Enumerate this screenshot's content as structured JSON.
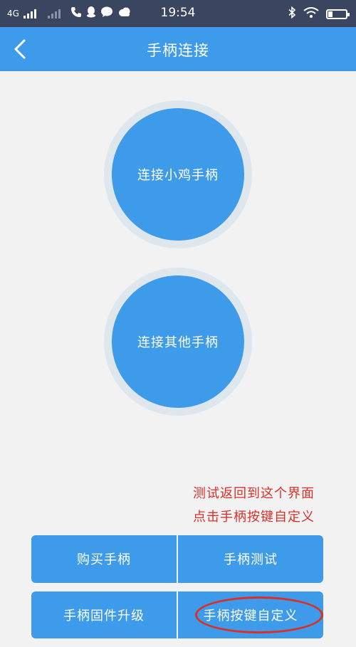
{
  "status_bar": {
    "network": "4G",
    "time": "19:54"
  },
  "header": {
    "title": "手柄连接"
  },
  "circles": {
    "connect_xiaoji": "连接小鸡手柄",
    "connect_other": "连接其他手柄"
  },
  "annotation": {
    "line1": "测试返回到这个界面",
    "line2": "点击手柄按键自定义"
  },
  "buttons": {
    "buy": "购买手柄",
    "test": "手柄测试",
    "firmware": "手柄固件升级",
    "customize": "手柄按键自定义"
  },
  "colors": {
    "primary": "#3d9be9",
    "status_bar": "#3a4660",
    "annotation": "#d8302a",
    "background": "#f2f2f2"
  }
}
